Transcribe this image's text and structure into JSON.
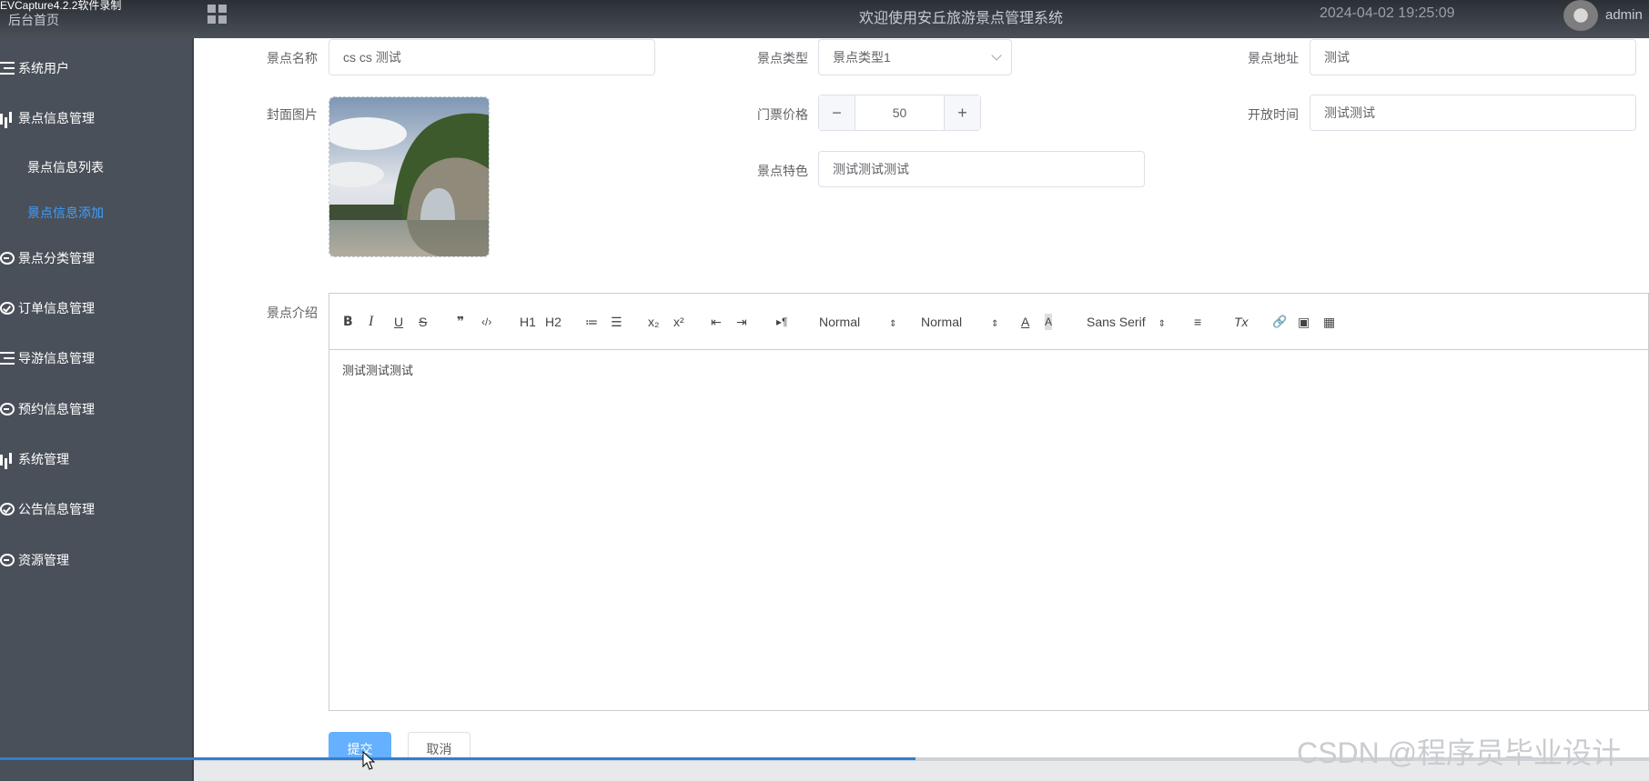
{
  "recorder": {
    "label": "EVCapture4.2.2软件录制"
  },
  "header": {
    "home": "后台首页",
    "title": "欢迎使用安丘旅游景点管理系统",
    "datetime": "2024-04-02 19:25:09",
    "user": "admin"
  },
  "sidebar": {
    "items": [
      {
        "label": "系统用户",
        "icon": "list-icon"
      },
      {
        "label": "景点信息管理",
        "icon": "bar-chart-icon"
      },
      {
        "label": "景点分类管理",
        "icon": "chat-icon"
      },
      {
        "label": "订单信息管理",
        "icon": "check-circle-icon"
      },
      {
        "label": "导游信息管理",
        "icon": "list-icon"
      },
      {
        "label": "预约信息管理",
        "icon": "chat-icon"
      },
      {
        "label": "系统管理",
        "icon": "bar-chart-icon"
      },
      {
        "label": "公告信息管理",
        "icon": "check-circle-icon"
      },
      {
        "label": "资源管理",
        "icon": "chat-icon"
      }
    ],
    "sub_items": [
      {
        "label": "景点信息列表",
        "active": false
      },
      {
        "label": "景点信息添加",
        "active": true
      }
    ],
    "active_color": "#409eff"
  },
  "form": {
    "name_label": "景点名称",
    "name_value": "cs cs 测试",
    "type_label": "景点类型",
    "type_value": "景点类型1",
    "address_label": "景点地址",
    "address_value": "测试",
    "cover_label": "封面图片",
    "price_label": "门票价格",
    "price_value": "50",
    "open_label": "开放时间",
    "open_value": "测试测试",
    "feature_label": "景点特色",
    "feature_value": "测试测试测试",
    "intro_label": "景点介绍"
  },
  "editor": {
    "toolbar": {
      "bold": "B",
      "italic": "I",
      "underline": "U",
      "strike": "S",
      "quote": "❞",
      "code": "‹/›",
      "h1": "H1",
      "h2": "H2",
      "ordered": "≔",
      "bullet": "☰",
      "sub": "x₂",
      "sup": "x²",
      "outdent": "⇤",
      "indent": "⇥",
      "direction": "▸¶",
      "size_picker": "Normal",
      "header_picker": "Normal",
      "color": "A",
      "background": "A",
      "font_picker": "Sans Serif",
      "align": "≡",
      "clean": "Tx",
      "link": "🔗",
      "image": "▣",
      "video": "▦"
    },
    "content": "测试测试测试"
  },
  "buttons": {
    "submit": "提交",
    "cancel": "取消"
  },
  "watermark": "CSDN @程序员毕业设计",
  "progress": 0.555,
  "colors": {
    "primary": "#66b1ff",
    "sidebar_bg": "#4a5059"
  }
}
